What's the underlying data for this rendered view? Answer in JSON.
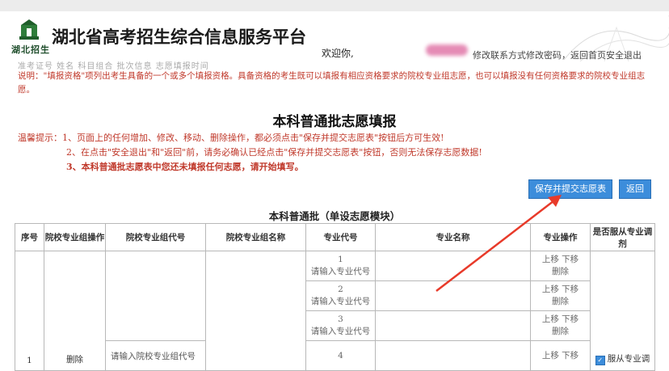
{
  "header": {
    "logo_text": "湖北招生",
    "site_title": "湖北省高考招生综合信息服务平台",
    "welcome": "欢迎你,",
    "links": "修改联系方式修改密码，返回首页安全退出",
    "faint_row": "准考证号   姓名   科目组合   批次信息   志愿填报时间"
  },
  "note": "说明：\"填报资格\"项列出考生具备的一个或多个填报资格。具备资格的考生既可以填报有相应资格要求的院校专业组志愿，也可以填报没有任何资格要求的院校专业组志愿。",
  "page_title": "本科普通批志愿填报",
  "tips": [
    "温馨提示：1、页面上的任何增加、修改、移动、删除操作，都必须点击\"保存并提交志愿表\"按钮后方可生效!",
    "2、在点击\"安全退出\"和\"返回\"前，请务必确认已经点击\"保存并提交志愿表\"按钮，否则无法保存志愿数据!",
    "3、本科普通批志愿表中您还未填报任何志愿，请开始填写。"
  ],
  "buttons": {
    "save": "保存并提交志愿表",
    "back": "返回"
  },
  "table": {
    "title": "本科普通批（单设志愿模块）",
    "headers": [
      "序号",
      "院校专业组操作",
      "院校专业组代号",
      "院校专业组名称",
      "专业代号",
      "专业名称",
      "专业操作",
      "是否服从专业调剂"
    ],
    "row_index": "1",
    "row_op": "删除",
    "group_code_placeholder": "请输入院校专业组代号",
    "major_code_placeholder": "请输入专业代号",
    "major_rows": [
      "1",
      "2",
      "3",
      "4"
    ],
    "major_op_line1": "上移 下移",
    "major_op_line2": "删除",
    "obey_label": "服从专业调"
  },
  "colors": {
    "accent": "#3c8ddb",
    "warning": "#c0392b",
    "arrow": "#e83a2a"
  }
}
